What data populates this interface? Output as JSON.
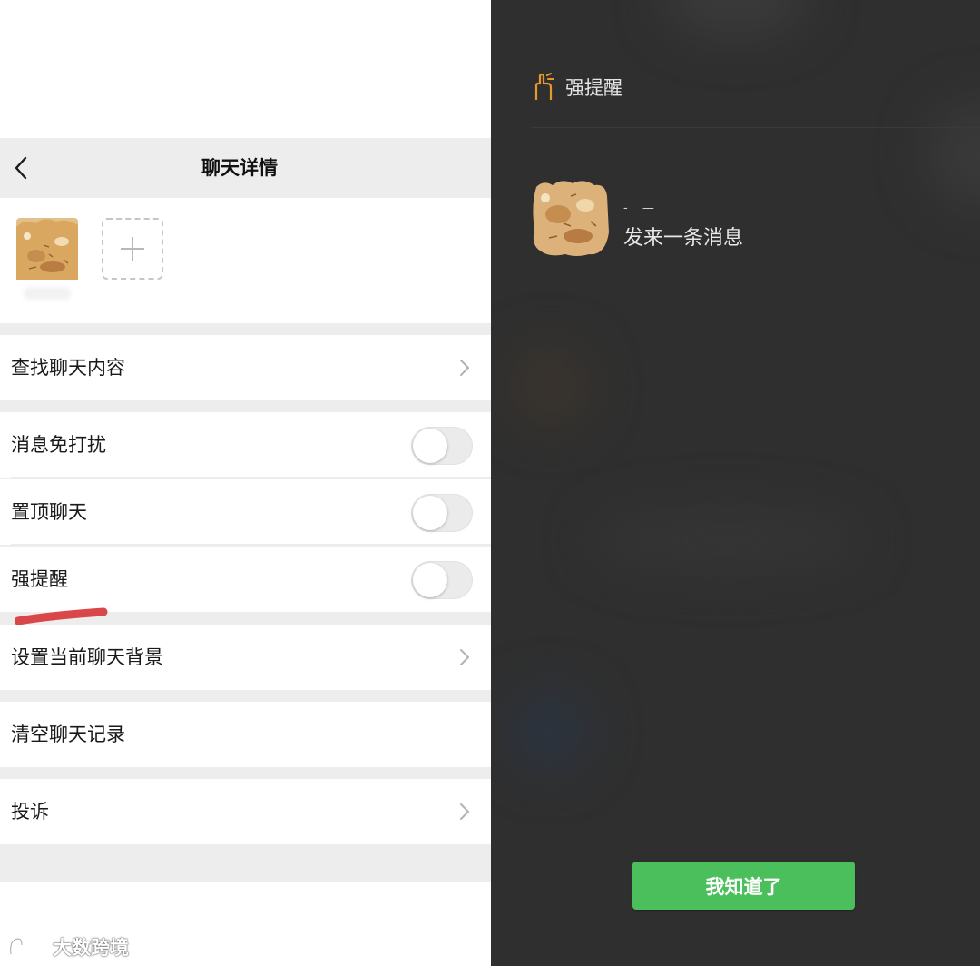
{
  "nav": {
    "title": "聊天详情",
    "back_icon": "chevron-left-icon"
  },
  "members": {
    "add_icon": "plus-icon"
  },
  "settings": {
    "search_chat": "查找聊天内容",
    "mute_notifications": {
      "label": "消息免打扰",
      "on": false
    },
    "sticky_on_top": {
      "label": "置顶聊天",
      "on": false
    },
    "strong_reminder": {
      "label": "强提醒",
      "on": false
    },
    "set_background": "设置当前聊天背景",
    "clear_history": "清空聊天记录",
    "complain": "投诉"
  },
  "alert": {
    "icon": "reminder-hand-icon",
    "title": "强提醒",
    "sender": "- —",
    "message": "发来一条消息",
    "button_label": "我知道了"
  },
  "watermark": {
    "text": "大数跨境",
    "icon": "logo-icon"
  },
  "colors": {
    "accent_green": "#4bbf5c",
    "alert_orange": "#e8972f",
    "highlight_red": "#d9474b",
    "dark_bg": "#2f2f2f",
    "page_gray": "#ededed"
  }
}
